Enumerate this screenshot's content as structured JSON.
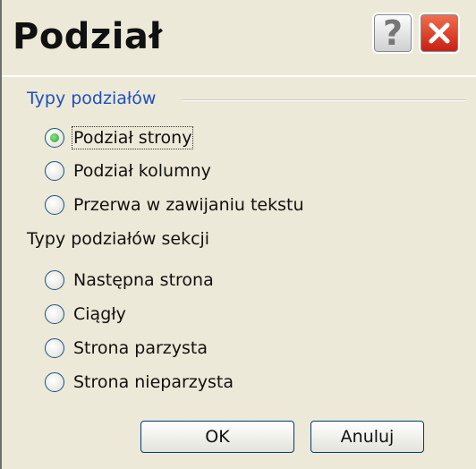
{
  "window": {
    "title": "Podział",
    "help_glyph": "?",
    "close_glyph": "✕"
  },
  "break_types": {
    "label": "Typy podziałów",
    "options": [
      {
        "label": "Podział strony",
        "checked": true
      },
      {
        "label": "Podział kolumny",
        "checked": false
      },
      {
        "label": "Przerwa w zawijaniu tekstu",
        "checked": false
      }
    ]
  },
  "section_break_types": {
    "label": "Typy podziałów sekcji",
    "options": [
      {
        "label": "Następna strona",
        "checked": false
      },
      {
        "label": "Ciągły",
        "checked": false
      },
      {
        "label": "Strona parzysta",
        "checked": false
      },
      {
        "label": "Strona nieparzysta",
        "checked": false
      }
    ]
  },
  "buttons": {
    "ok": "OK",
    "cancel": "Anuluj"
  },
  "colors": {
    "background": "#ece9d8",
    "group_label": "#1f4fbf",
    "close_button": "#c81e10",
    "radio_checked": "#21a121"
  }
}
